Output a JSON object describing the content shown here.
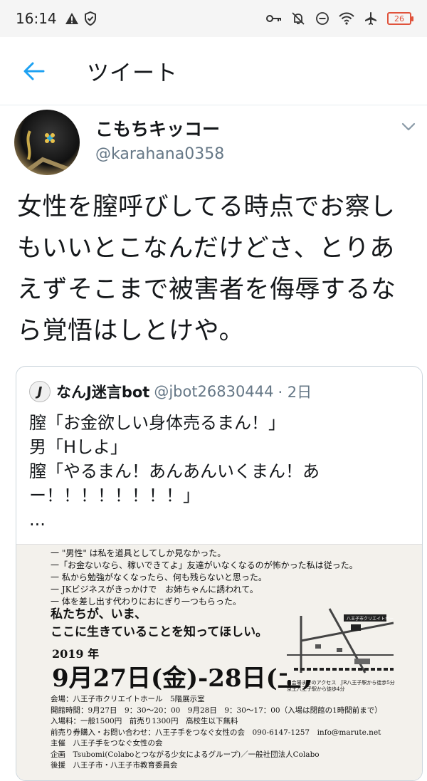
{
  "status_bar": {
    "time": "16:14",
    "battery": "26"
  },
  "header": {
    "title": "ツイート"
  },
  "tweet": {
    "author_name": "こもちキッコー",
    "author_handle": "@karahana0358",
    "text_lines": [
      "女性を膣呼びしてる時点でお察し",
      "もいいとこなんだけどさ、とりあ",
      "えずそこまで被害者を侮辱するな",
      "ら覚悟はしとけや。"
    ]
  },
  "quote": {
    "avatar_letter": "J",
    "name": "なんJ迷言bot",
    "handle": "@jbot26830444",
    "time": "· 2日",
    "lines": [
      "膣「お金欲しい身体売るまん！」",
      "男「Hしよ」",
      "膣「やるまん！あんあんいくまん！あ",
      "ー！！！！！！！！」",
      "..."
    ]
  },
  "poster": {
    "top_lines": [
      "一 \"男性\" は私を道具としてしか見なかった。",
      "一「お金ないなら、稼いできてよ」友達がいなくなるのが怖かった私は従った。",
      "一 私から勉強がなくなったら、何も残らないと思った。",
      "一 JKビジネスがきっかけで　お姉ちゃんに誘われて。",
      "一 体を差し出す代わりにおにぎり一つもらった。"
    ],
    "headline": [
      "私たちが、いま、",
      "ここに生きていることを知ってほしい。"
    ],
    "year": "2019 年",
    "date": "9月27日(金)-28日(土)",
    "info": [
      "会場：八王子市クリエイトホール　5階展示室",
      "開館時間：9月27日　9：30～20：00　9月28日　9：30～17：00（入場は閉館の1時間前まで）",
      "入場料：一般1500円　前売り1300円　高校生以下無料",
      "前売り券購入・お問い合わせ：八王子手をつなぐ女性の会　090-6147-1257　info@marute.net",
      "主催　八王子手をつなぐ女性の会",
      "企画　Tsubomi(Colaboとつながる少女によるグループ)／一般社団法人Colabo",
      "後援　八王子市・八王子市教育委員会"
    ],
    "map_label": "八王子市クリエイトホール",
    "map_caption": [
      "■会場までのアクセス　JR八王子駅から徒歩5分",
      "京王八王子駅から徒歩4分"
    ]
  },
  "colors": {
    "accent": "#1da1f2",
    "secondary_text": "#657786",
    "border": "#ccd6dd"
  }
}
